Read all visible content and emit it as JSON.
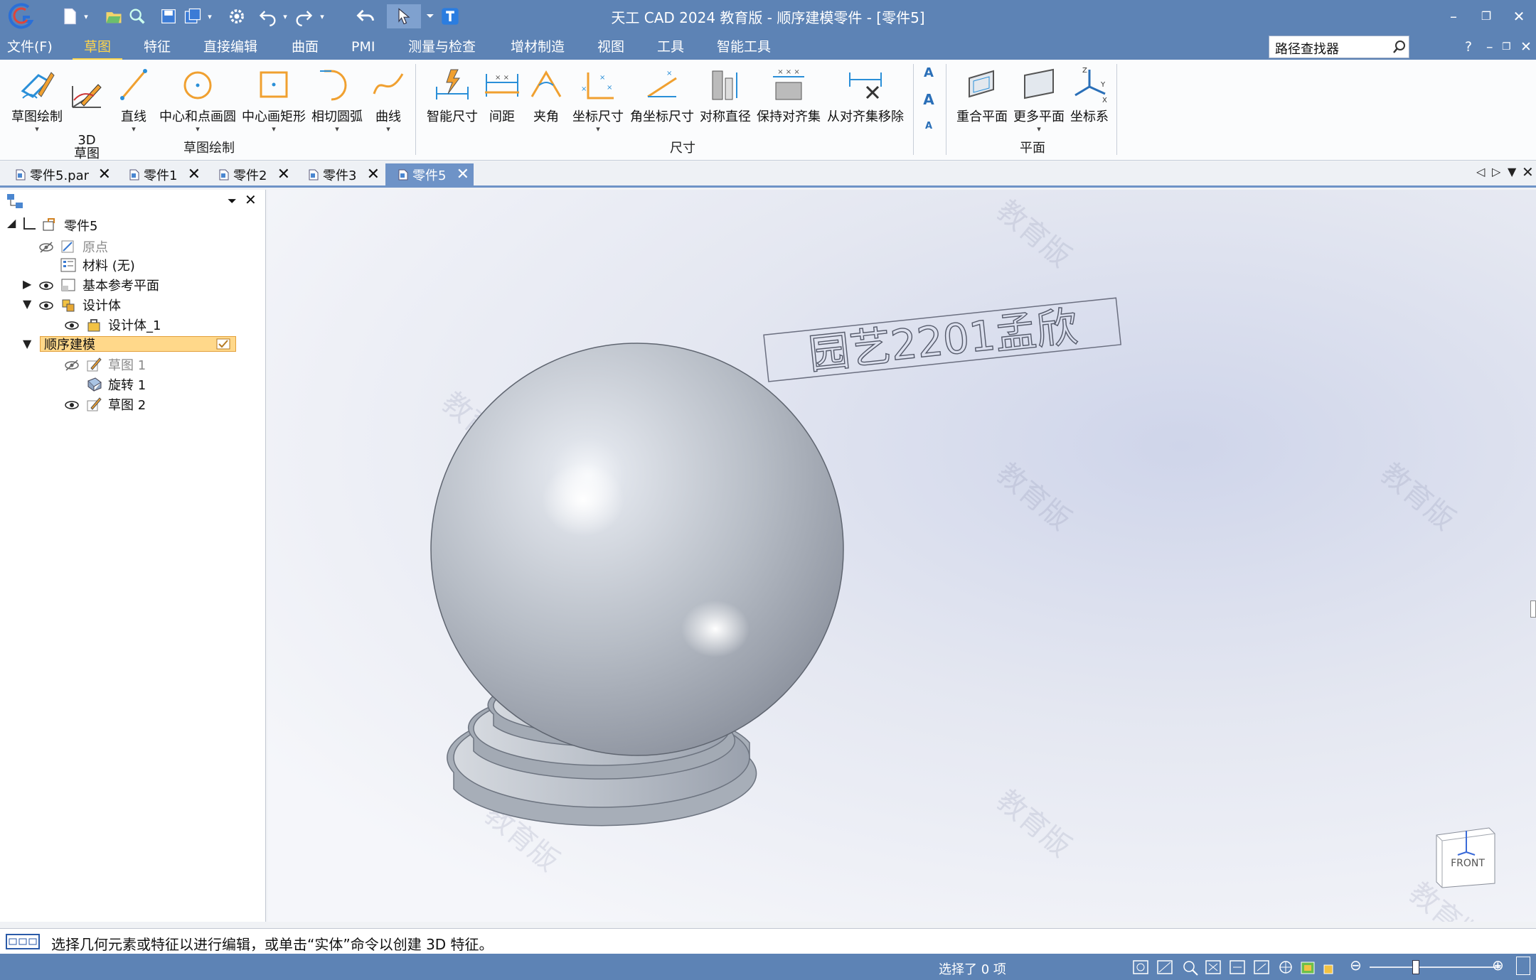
{
  "window": {
    "title": "天工 CAD 2024 教育版 - 顺序建模零件 - [零件5]"
  },
  "menubar": {
    "items": [
      "文件(F)",
      "草图",
      "特征",
      "直接编辑",
      "曲面",
      "PMI",
      "测量与检查",
      "增材制造",
      "视图",
      "工具",
      "智能工具"
    ],
    "active": "草图",
    "search_value": "路径查找器",
    "help": "?"
  },
  "ribbon": {
    "sketch_group": {
      "label": "草图绘制",
      "buttons": [
        "草图绘制",
        "3D\n草图",
        "直线",
        "中心和点画圆",
        "中心画矩形",
        "相切圆弧",
        "曲线"
      ]
    },
    "dim_group": {
      "label": "尺寸",
      "buttons": [
        "智能尺寸",
        "间距",
        "夹角",
        "坐标尺寸",
        "角坐标尺寸",
        "对称直径",
        "保持对齐集",
        "从对齐集移除"
      ]
    },
    "plane_group": {
      "label": "平面",
      "buttons": [
        "重合平面",
        "更多平面",
        "坐标系"
      ]
    }
  },
  "tabs": [
    {
      "label": "零件5.par",
      "active": false
    },
    {
      "label": "零件1",
      "active": false
    },
    {
      "label": "零件2",
      "active": false
    },
    {
      "label": "零件3",
      "active": false
    },
    {
      "label": "零件5",
      "active": true
    }
  ],
  "tree": {
    "root": "零件5",
    "origin": "原点",
    "material": "材料 (无)",
    "ref_planes": "基本参考平面",
    "design_body": "设计体",
    "design_body_1": "设计体_1",
    "ordered": "顺序建模",
    "sketch1": "草图 1",
    "revolve1": "旋转 1",
    "sketch2": "草图 2"
  },
  "viewport": {
    "annotation": "园艺2201孟欣",
    "watermark": "教育版",
    "view_cube": "FRONT"
  },
  "status": {
    "prompt": "选择几何元素或特征以进行编辑，或单击“实体”命令以创建 3D 特征。",
    "selected": "选择了 0 项"
  },
  "colors": {
    "titlebar": "#5d83b5",
    "active_menu": "#ffd54a",
    "active_tab": "#6e93c7",
    "highlight": "#ffd88a"
  }
}
